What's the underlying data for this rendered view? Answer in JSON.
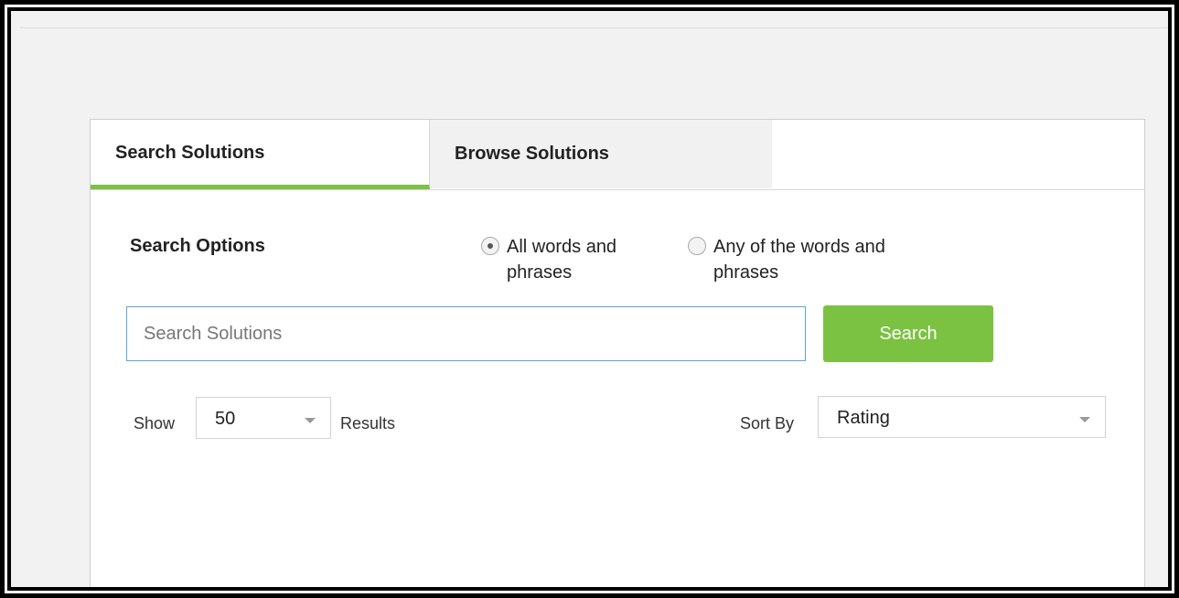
{
  "tabs": {
    "search_label": "Search Solutions",
    "browse_label": "Browse Solutions"
  },
  "search_options": {
    "label": "Search Options",
    "option_all": "All words and phrases",
    "option_any": "Any of the words and phrases",
    "selected": "option_all"
  },
  "search": {
    "placeholder": "Search Solutions",
    "value": "",
    "button_label": "Search"
  },
  "results": {
    "show_label": "Show",
    "count_value": "50",
    "results_label": "Results",
    "sort_label": "Sort By",
    "sort_value": "Rating"
  },
  "colors": {
    "accent_green": "#7cc242",
    "input_focus_blue": "#5aa6e0"
  },
  "icons": {
    "dropdown": "chevron-down-icon"
  }
}
